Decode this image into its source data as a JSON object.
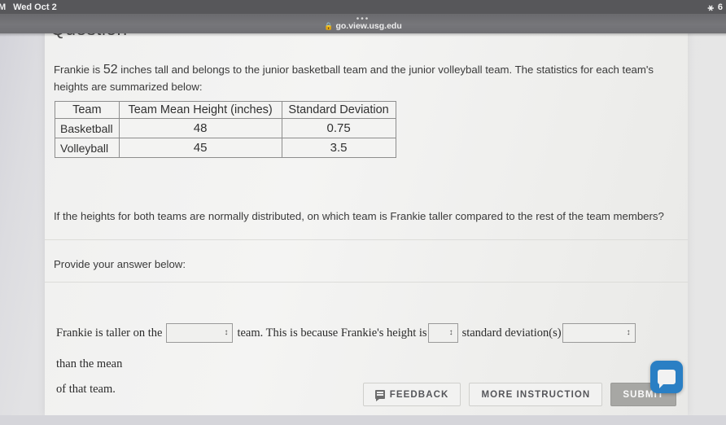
{
  "statusbar": {
    "time_text": "AM",
    "date_text": "Wed Oct 2",
    "wifi_icon": "wifi-icon",
    "battery_text": "6"
  },
  "browser": {
    "dots": "•••",
    "lock_icon": "lock-icon",
    "url": "go.view.usg.edu"
  },
  "page": {
    "title": "Question"
  },
  "question": {
    "prompt_pre": "Frankie is ",
    "prompt_number": "52",
    "prompt_post": " inches tall and belongs to the junior basketball team and the junior volleyball team. The statistics for each team's heights are summarized below:",
    "followup": "If the heights for both teams are normally distributed, on which team is Frankie taller compared to the rest of the team members?",
    "provide_label": "Provide your answer below:"
  },
  "table": {
    "headers": [
      "Team",
      "Team Mean Height (inches)",
      "Standard Deviation"
    ],
    "rows": [
      [
        "Basketball",
        "48",
        "0.75"
      ],
      [
        "Volleyball",
        "45",
        "3.5"
      ]
    ]
  },
  "answer": {
    "text1": "Frankie is taller on the",
    "dropdown1_value": "",
    "text2": "team. This is because Frankie's height is",
    "dropdown2_value": "",
    "text3": "standard deviation(s)",
    "dropdown3_value": "",
    "text4": "than the mean",
    "text5": "of that team.",
    "chevron_icon": "chevron-updown-icon"
  },
  "buttons": {
    "feedback": "FEEDBACK",
    "feedback_icon": "comment-icon",
    "more_instruction": "MORE INSTRUCTION",
    "submit": "SUBMIT"
  },
  "chat": {
    "icon": "chat-bubble-icon",
    "accent_color": "#2a7fc4"
  }
}
